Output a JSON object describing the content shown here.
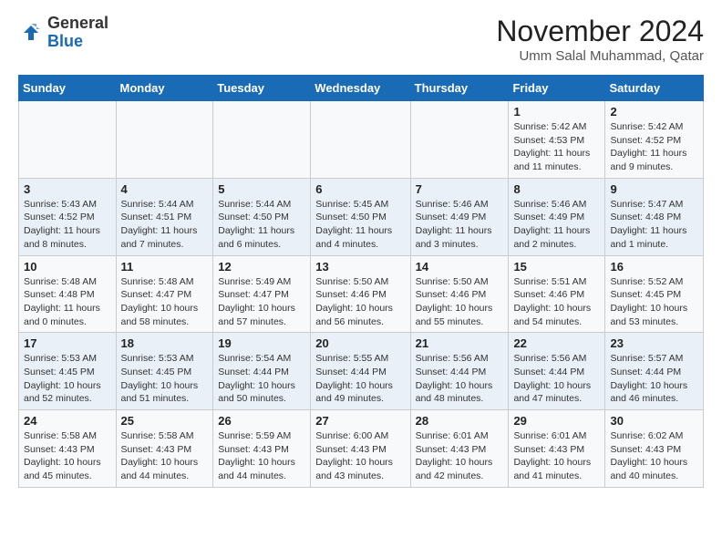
{
  "logo": {
    "text_general": "General",
    "text_blue": "Blue"
  },
  "title": "November 2024",
  "subtitle": "Umm Salal Muhammad, Qatar",
  "weekdays": [
    "Sunday",
    "Monday",
    "Tuesday",
    "Wednesday",
    "Thursday",
    "Friday",
    "Saturday"
  ],
  "weeks": [
    [
      {
        "day": "",
        "info": ""
      },
      {
        "day": "",
        "info": ""
      },
      {
        "day": "",
        "info": ""
      },
      {
        "day": "",
        "info": ""
      },
      {
        "day": "",
        "info": ""
      },
      {
        "day": "1",
        "info": "Sunrise: 5:42 AM\nSunset: 4:53 PM\nDaylight: 11 hours and 11 minutes."
      },
      {
        "day": "2",
        "info": "Sunrise: 5:42 AM\nSunset: 4:52 PM\nDaylight: 11 hours and 9 minutes."
      }
    ],
    [
      {
        "day": "3",
        "info": "Sunrise: 5:43 AM\nSunset: 4:52 PM\nDaylight: 11 hours and 8 minutes."
      },
      {
        "day": "4",
        "info": "Sunrise: 5:44 AM\nSunset: 4:51 PM\nDaylight: 11 hours and 7 minutes."
      },
      {
        "day": "5",
        "info": "Sunrise: 5:44 AM\nSunset: 4:50 PM\nDaylight: 11 hours and 6 minutes."
      },
      {
        "day": "6",
        "info": "Sunrise: 5:45 AM\nSunset: 4:50 PM\nDaylight: 11 hours and 4 minutes."
      },
      {
        "day": "7",
        "info": "Sunrise: 5:46 AM\nSunset: 4:49 PM\nDaylight: 11 hours and 3 minutes."
      },
      {
        "day": "8",
        "info": "Sunrise: 5:46 AM\nSunset: 4:49 PM\nDaylight: 11 hours and 2 minutes."
      },
      {
        "day": "9",
        "info": "Sunrise: 5:47 AM\nSunset: 4:48 PM\nDaylight: 11 hours and 1 minute."
      }
    ],
    [
      {
        "day": "10",
        "info": "Sunrise: 5:48 AM\nSunset: 4:48 PM\nDaylight: 11 hours and 0 minutes."
      },
      {
        "day": "11",
        "info": "Sunrise: 5:48 AM\nSunset: 4:47 PM\nDaylight: 10 hours and 58 minutes."
      },
      {
        "day": "12",
        "info": "Sunrise: 5:49 AM\nSunset: 4:47 PM\nDaylight: 10 hours and 57 minutes."
      },
      {
        "day": "13",
        "info": "Sunrise: 5:50 AM\nSunset: 4:46 PM\nDaylight: 10 hours and 56 minutes."
      },
      {
        "day": "14",
        "info": "Sunrise: 5:50 AM\nSunset: 4:46 PM\nDaylight: 10 hours and 55 minutes."
      },
      {
        "day": "15",
        "info": "Sunrise: 5:51 AM\nSunset: 4:46 PM\nDaylight: 10 hours and 54 minutes."
      },
      {
        "day": "16",
        "info": "Sunrise: 5:52 AM\nSunset: 4:45 PM\nDaylight: 10 hours and 53 minutes."
      }
    ],
    [
      {
        "day": "17",
        "info": "Sunrise: 5:53 AM\nSunset: 4:45 PM\nDaylight: 10 hours and 52 minutes."
      },
      {
        "day": "18",
        "info": "Sunrise: 5:53 AM\nSunset: 4:45 PM\nDaylight: 10 hours and 51 minutes."
      },
      {
        "day": "19",
        "info": "Sunrise: 5:54 AM\nSunset: 4:44 PM\nDaylight: 10 hours and 50 minutes."
      },
      {
        "day": "20",
        "info": "Sunrise: 5:55 AM\nSunset: 4:44 PM\nDaylight: 10 hours and 49 minutes."
      },
      {
        "day": "21",
        "info": "Sunrise: 5:56 AM\nSunset: 4:44 PM\nDaylight: 10 hours and 48 minutes."
      },
      {
        "day": "22",
        "info": "Sunrise: 5:56 AM\nSunset: 4:44 PM\nDaylight: 10 hours and 47 minutes."
      },
      {
        "day": "23",
        "info": "Sunrise: 5:57 AM\nSunset: 4:44 PM\nDaylight: 10 hours and 46 minutes."
      }
    ],
    [
      {
        "day": "24",
        "info": "Sunrise: 5:58 AM\nSunset: 4:43 PM\nDaylight: 10 hours and 45 minutes."
      },
      {
        "day": "25",
        "info": "Sunrise: 5:58 AM\nSunset: 4:43 PM\nDaylight: 10 hours and 44 minutes."
      },
      {
        "day": "26",
        "info": "Sunrise: 5:59 AM\nSunset: 4:43 PM\nDaylight: 10 hours and 44 minutes."
      },
      {
        "day": "27",
        "info": "Sunrise: 6:00 AM\nSunset: 4:43 PM\nDaylight: 10 hours and 43 minutes."
      },
      {
        "day": "28",
        "info": "Sunrise: 6:01 AM\nSunset: 4:43 PM\nDaylight: 10 hours and 42 minutes."
      },
      {
        "day": "29",
        "info": "Sunrise: 6:01 AM\nSunset: 4:43 PM\nDaylight: 10 hours and 41 minutes."
      },
      {
        "day": "30",
        "info": "Sunrise: 6:02 AM\nSunset: 4:43 PM\nDaylight: 10 hours and 40 minutes."
      }
    ]
  ]
}
